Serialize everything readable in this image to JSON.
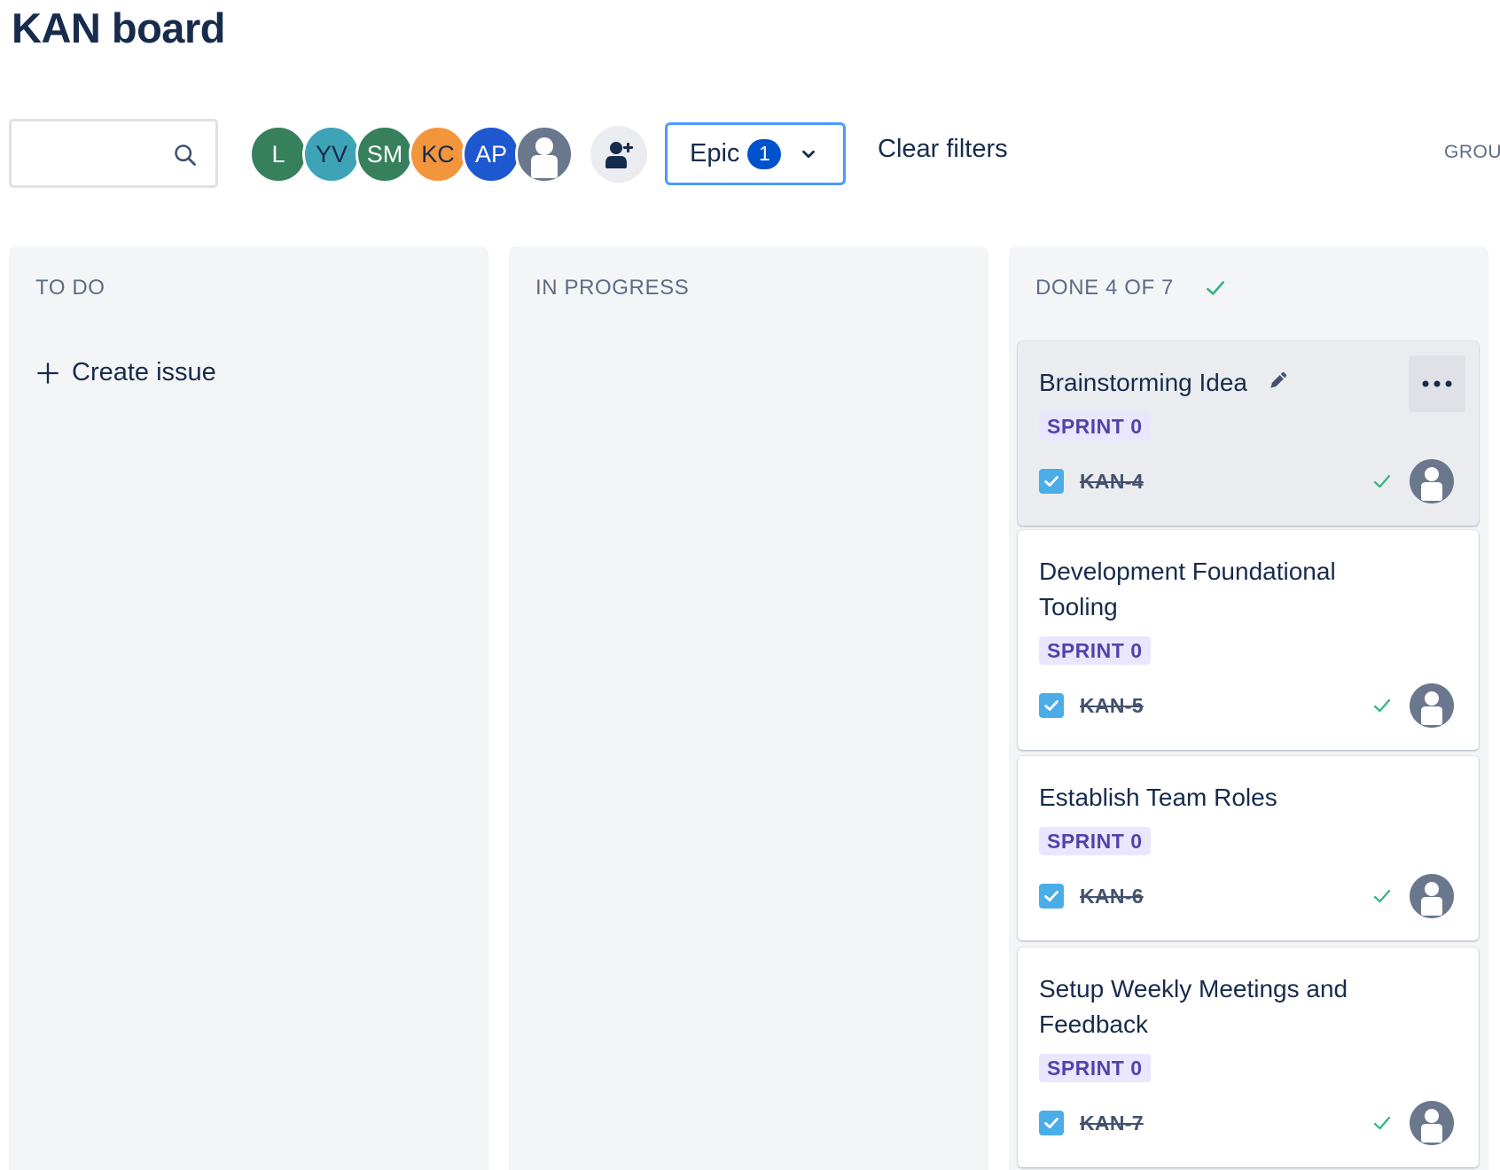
{
  "board": {
    "title": "KAN board"
  },
  "toolbar": {
    "search": {
      "value": "",
      "placeholder": ""
    },
    "avatars": [
      {
        "initials": "L",
        "color": "#36805c"
      },
      {
        "initials": "YV",
        "color": "#3fa3b7"
      },
      {
        "initials": "SM",
        "color": "#36805c"
      },
      {
        "initials": "KC",
        "color": "#f3953b"
      },
      {
        "initials": "AP",
        "color": "#1e58d0"
      },
      {
        "initials": "",
        "color": "#6b778c",
        "icon": "person-icon"
      }
    ],
    "add_people_icon": "add-person-icon",
    "epic_filter": {
      "label": "Epic",
      "count": "1"
    },
    "clear_filters_label": "Clear filters",
    "group_by_label": "GROU"
  },
  "columns": [
    {
      "title": "TO DO",
      "create_issue_label": "Create issue",
      "cards": []
    },
    {
      "title": "IN PROGRESS",
      "cards": []
    },
    {
      "title": "DONE 4 OF 7",
      "done_icon": "check-icon",
      "cards": [
        {
          "summary": "Brainstorming Idea",
          "sprint": "SPRINT 0",
          "key": "KAN-4",
          "resolved": true,
          "hovered": true
        },
        {
          "summary": "Development Foundational Tooling",
          "sprint": "SPRINT 0",
          "key": "KAN-5",
          "resolved": true
        },
        {
          "summary": "Establish Team Roles",
          "sprint": "SPRINT 0",
          "key": "KAN-6",
          "resolved": true
        },
        {
          "summary": "Setup Weekly Meetings and Feedback",
          "sprint": "SPRINT 0",
          "key": "KAN-7",
          "resolved": true
        }
      ]
    }
  ],
  "colors": {
    "accent": "#0052cc",
    "focus_border": "#4c9aff",
    "column_bg": "#f4f5f7",
    "success": "#36b37e",
    "lozenge_bg": "#eae6ff",
    "lozenge_text": "#5243aa",
    "task_icon": "#4bade8"
  }
}
